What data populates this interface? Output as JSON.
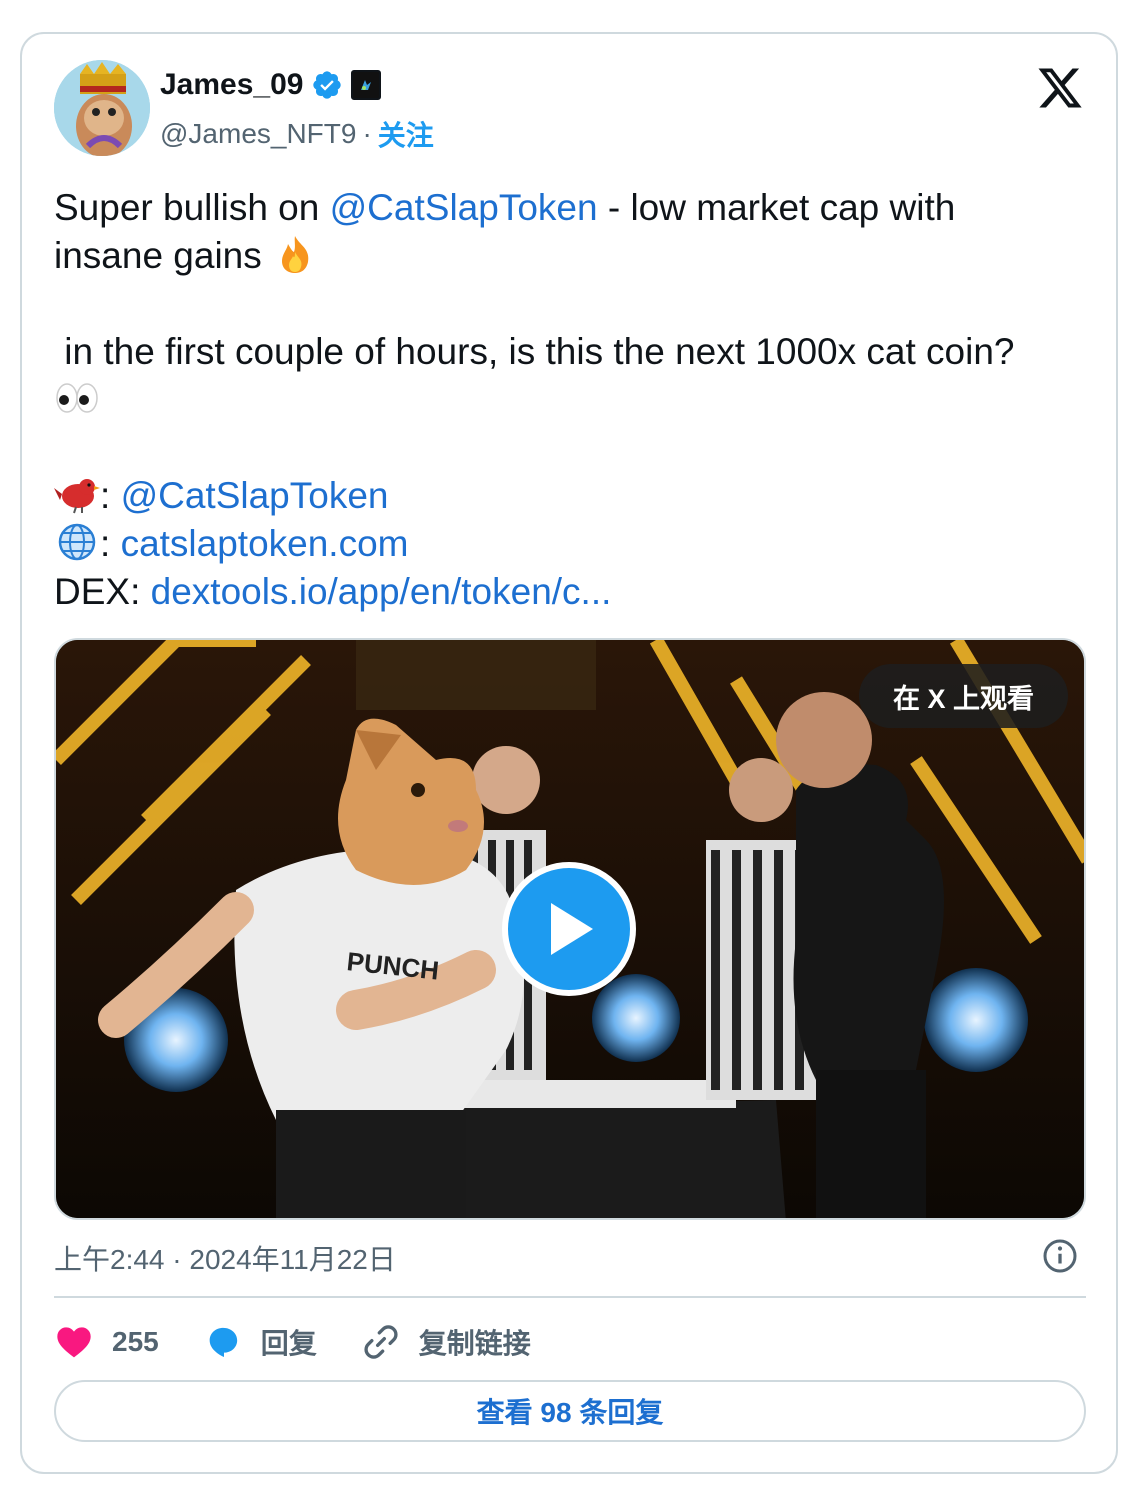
{
  "author": {
    "display_name": "James_09",
    "handle": "@James_NFT9",
    "separator": "·",
    "follow_label": "关注"
  },
  "tweet": {
    "line1_prefix": "Super bullish on ",
    "line1_mention": "@CatSlapToken",
    "line1_suffix": " - low market cap with",
    "line2": "insane gains ",
    "line3": " in the first couple of hours, is this the next 1000x cat coin?",
    "twitter_label": ": ",
    "twitter_link": "@CatSlapToken",
    "web_label": ": ",
    "web_link": "catslaptoken.com",
    "dex_label": "DEX: ",
    "dex_link": "dextools.io/app/en/token/c..."
  },
  "media": {
    "watch_label": "在 X 上观看"
  },
  "meta": {
    "timestamp": "上午2:44 · 2024年11月22日"
  },
  "actions": {
    "likes": "255",
    "reply_label": "回复",
    "copy_link_label": "复制链接"
  },
  "view_replies_label": "查看 98 条回复",
  "colors": {
    "link": "#1d6fd0",
    "accent": "#1d9bf0",
    "like": "#f91880",
    "muted": "#536471",
    "border": "#cfd9de"
  }
}
